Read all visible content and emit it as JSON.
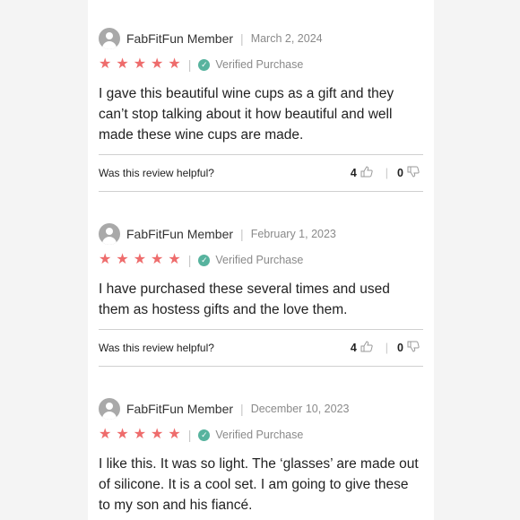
{
  "reviews": [
    {
      "author": "FabFitFun Member",
      "date": "March 2, 2024",
      "verified": "Verified Purchase",
      "rating": 5,
      "text": "I gave this beautiful wine cups as a gift and they can’t stop talking about it how beautiful and well made these wine cups are made.",
      "helpful_question": "Was this review helpful?",
      "helpful_yes": "4",
      "helpful_no": "0"
    },
    {
      "author": "FabFitFun Member",
      "date": "February 1, 2023",
      "verified": "Verified Purchase",
      "rating": 5,
      "text": "I have purchased these several times and used them as hostess gifts and the love them.",
      "helpful_question": "Was this review helpful?",
      "helpful_yes": "4",
      "helpful_no": "0"
    },
    {
      "author": "FabFitFun Member",
      "date": "December 10, 2023",
      "verified": "Verified Purchase",
      "rating": 5,
      "text": "I like this. It was so light. The ‘glasses’ are made out of silicone. It is a cool set. I am going to give these to my son and his fiancé."
    }
  ],
  "colors": {
    "star": "#ee6c6c",
    "verified_check": "#57b39e",
    "avatar": "#a9a9a9"
  }
}
